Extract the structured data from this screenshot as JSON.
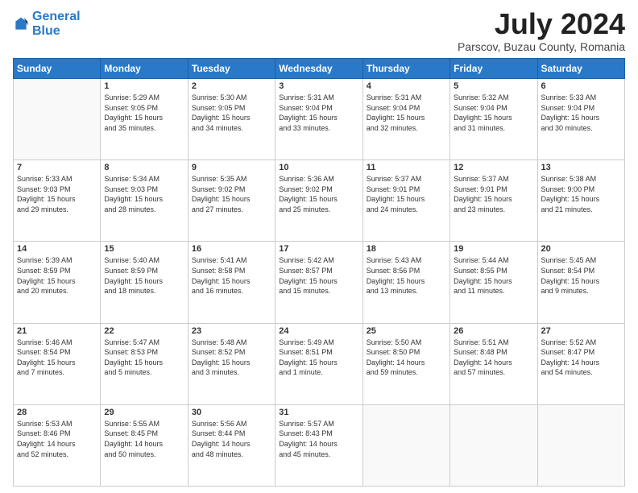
{
  "logo": {
    "line1": "General",
    "line2": "Blue"
  },
  "title": "July 2024",
  "location": "Parscov, Buzau County, Romania",
  "weekdays": [
    "Sunday",
    "Monday",
    "Tuesday",
    "Wednesday",
    "Thursday",
    "Friday",
    "Saturday"
  ],
  "weeks": [
    [
      {
        "day": null
      },
      {
        "day": "1",
        "sunrise": "5:29 AM",
        "sunset": "9:05 PM",
        "daylight": "15 hours and 35 minutes."
      },
      {
        "day": "2",
        "sunrise": "5:30 AM",
        "sunset": "9:05 PM",
        "daylight": "15 hours and 34 minutes."
      },
      {
        "day": "3",
        "sunrise": "5:31 AM",
        "sunset": "9:04 PM",
        "daylight": "15 hours and 33 minutes."
      },
      {
        "day": "4",
        "sunrise": "5:31 AM",
        "sunset": "9:04 PM",
        "daylight": "15 hours and 32 minutes."
      },
      {
        "day": "5",
        "sunrise": "5:32 AM",
        "sunset": "9:04 PM",
        "daylight": "15 hours and 31 minutes."
      },
      {
        "day": "6",
        "sunrise": "5:33 AM",
        "sunset": "9:04 PM",
        "daylight": "15 hours and 30 minutes."
      }
    ],
    [
      {
        "day": "7",
        "sunrise": "5:33 AM",
        "sunset": "9:03 PM",
        "daylight": "15 hours and 29 minutes."
      },
      {
        "day": "8",
        "sunrise": "5:34 AM",
        "sunset": "9:03 PM",
        "daylight": "15 hours and 28 minutes."
      },
      {
        "day": "9",
        "sunrise": "5:35 AM",
        "sunset": "9:02 PM",
        "daylight": "15 hours and 27 minutes."
      },
      {
        "day": "10",
        "sunrise": "5:36 AM",
        "sunset": "9:02 PM",
        "daylight": "15 hours and 25 minutes."
      },
      {
        "day": "11",
        "sunrise": "5:37 AM",
        "sunset": "9:01 PM",
        "daylight": "15 hours and 24 minutes."
      },
      {
        "day": "12",
        "sunrise": "5:37 AM",
        "sunset": "9:01 PM",
        "daylight": "15 hours and 23 minutes."
      },
      {
        "day": "13",
        "sunrise": "5:38 AM",
        "sunset": "9:00 PM",
        "daylight": "15 hours and 21 minutes."
      }
    ],
    [
      {
        "day": "14",
        "sunrise": "5:39 AM",
        "sunset": "8:59 PM",
        "daylight": "15 hours and 20 minutes."
      },
      {
        "day": "15",
        "sunrise": "5:40 AM",
        "sunset": "8:59 PM",
        "daylight": "15 hours and 18 minutes."
      },
      {
        "day": "16",
        "sunrise": "5:41 AM",
        "sunset": "8:58 PM",
        "daylight": "15 hours and 16 minutes."
      },
      {
        "day": "17",
        "sunrise": "5:42 AM",
        "sunset": "8:57 PM",
        "daylight": "15 hours and 15 minutes."
      },
      {
        "day": "18",
        "sunrise": "5:43 AM",
        "sunset": "8:56 PM",
        "daylight": "15 hours and 13 minutes."
      },
      {
        "day": "19",
        "sunrise": "5:44 AM",
        "sunset": "8:55 PM",
        "daylight": "15 hours and 11 minutes."
      },
      {
        "day": "20",
        "sunrise": "5:45 AM",
        "sunset": "8:54 PM",
        "daylight": "15 hours and 9 minutes."
      }
    ],
    [
      {
        "day": "21",
        "sunrise": "5:46 AM",
        "sunset": "8:54 PM",
        "daylight": "15 hours and 7 minutes."
      },
      {
        "day": "22",
        "sunrise": "5:47 AM",
        "sunset": "8:53 PM",
        "daylight": "15 hours and 5 minutes."
      },
      {
        "day": "23",
        "sunrise": "5:48 AM",
        "sunset": "8:52 PM",
        "daylight": "15 hours and 3 minutes."
      },
      {
        "day": "24",
        "sunrise": "5:49 AM",
        "sunset": "8:51 PM",
        "daylight": "15 hours and 1 minute."
      },
      {
        "day": "25",
        "sunrise": "5:50 AM",
        "sunset": "8:50 PM",
        "daylight": "14 hours and 59 minutes."
      },
      {
        "day": "26",
        "sunrise": "5:51 AM",
        "sunset": "8:48 PM",
        "daylight": "14 hours and 57 minutes."
      },
      {
        "day": "27",
        "sunrise": "5:52 AM",
        "sunset": "8:47 PM",
        "daylight": "14 hours and 54 minutes."
      }
    ],
    [
      {
        "day": "28",
        "sunrise": "5:53 AM",
        "sunset": "8:46 PM",
        "daylight": "14 hours and 52 minutes."
      },
      {
        "day": "29",
        "sunrise": "5:55 AM",
        "sunset": "8:45 PM",
        "daylight": "14 hours and 50 minutes."
      },
      {
        "day": "30",
        "sunrise": "5:56 AM",
        "sunset": "8:44 PM",
        "daylight": "14 hours and 48 minutes."
      },
      {
        "day": "31",
        "sunrise": "5:57 AM",
        "sunset": "8:43 PM",
        "daylight": "14 hours and 45 minutes."
      },
      {
        "day": null
      },
      {
        "day": null
      },
      {
        "day": null
      }
    ]
  ]
}
